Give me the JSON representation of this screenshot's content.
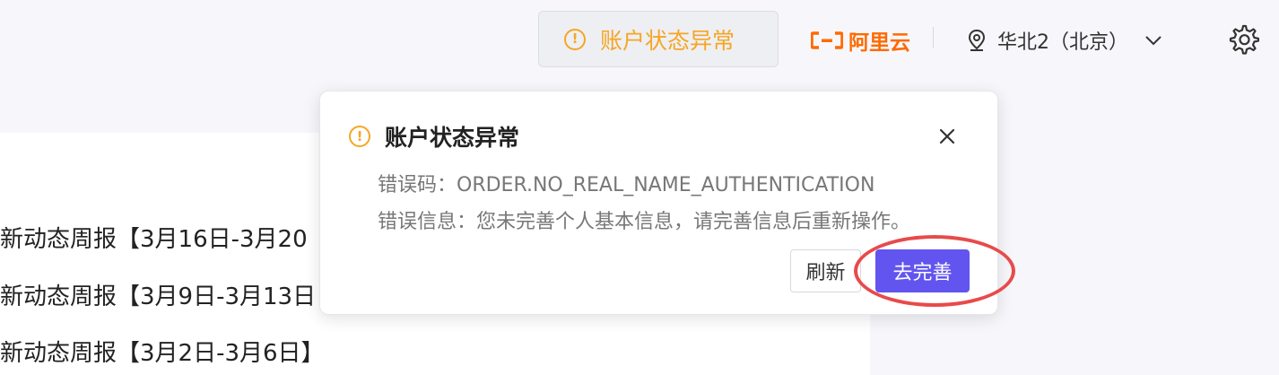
{
  "header": {
    "account_status_label": "账户状态异常",
    "logo_text": "阿里云",
    "region_label": "华北2（北京）"
  },
  "news": {
    "items": [
      "新动态周报【3月16日-3月20",
      "新动态周报【3月9日-3月13日",
      "新动态周报【3月2日-3月6日】"
    ]
  },
  "popover": {
    "title": "账户状态异常",
    "error_code_line": "错误码：ORDER.NO_REAL_NAME_AUTHENTICATION",
    "error_message_line": "错误信息：您未完善个人基本信息，请完善信息后重新操作。",
    "refresh_label": "刷新",
    "complete_label": "去完善"
  },
  "colors": {
    "warning": "#f5a623",
    "brand": "#ff6a00",
    "primary_button": "#6255ef",
    "highlight": "#e84a4a"
  },
  "icons": [
    "warning-icon",
    "aliyun-logo-icon",
    "location-pin-icon",
    "chevron-down-icon",
    "gear-icon",
    "close-icon"
  ]
}
